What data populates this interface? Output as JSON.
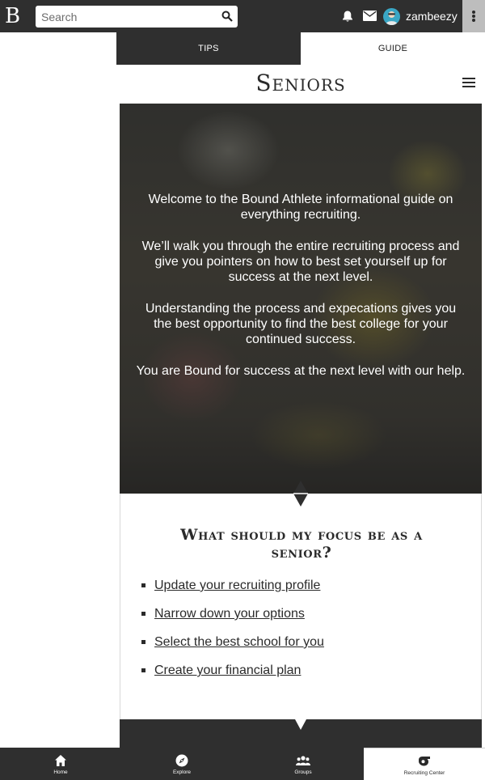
{
  "topbar": {
    "logo": "B",
    "search_placeholder": "Search",
    "username": "zambeezy"
  },
  "tabs": [
    {
      "label": "TIPS",
      "active": true
    },
    {
      "label": "GUIDE",
      "active": false
    }
  ],
  "page": {
    "title": "Seniors"
  },
  "hero": {
    "paragraphs": [
      "Welcome to the Bound Athlete informational guide on everything recruiting.",
      "We’ll walk you through the entire recruiting process and give you pointers on how to best set yourself up for success at the next level.",
      "Understanding the process and expecations gives you the best opportunity to find the best college for your continued success.",
      "You are Bound for success at the next level with our help."
    ]
  },
  "focus": {
    "title": "What should my focus be as a senior?",
    "items": [
      "Update your recruiting profile",
      "Narrow down your options",
      "Select the best school for you",
      "Create your financial plan"
    ]
  },
  "bottom_nav": [
    {
      "label": "Home",
      "icon": "home-icon",
      "active": false
    },
    {
      "label": "Explore",
      "icon": "compass-icon",
      "active": false
    },
    {
      "label": "Groups",
      "icon": "groups-icon",
      "active": false
    },
    {
      "label": "Recruiting Center",
      "icon": "whistle-icon",
      "active": true
    }
  ],
  "colors": {
    "bar": "#2f2f2f",
    "text_dark": "#2a2a2a",
    "accent_avatar": "#3aa7c5"
  }
}
